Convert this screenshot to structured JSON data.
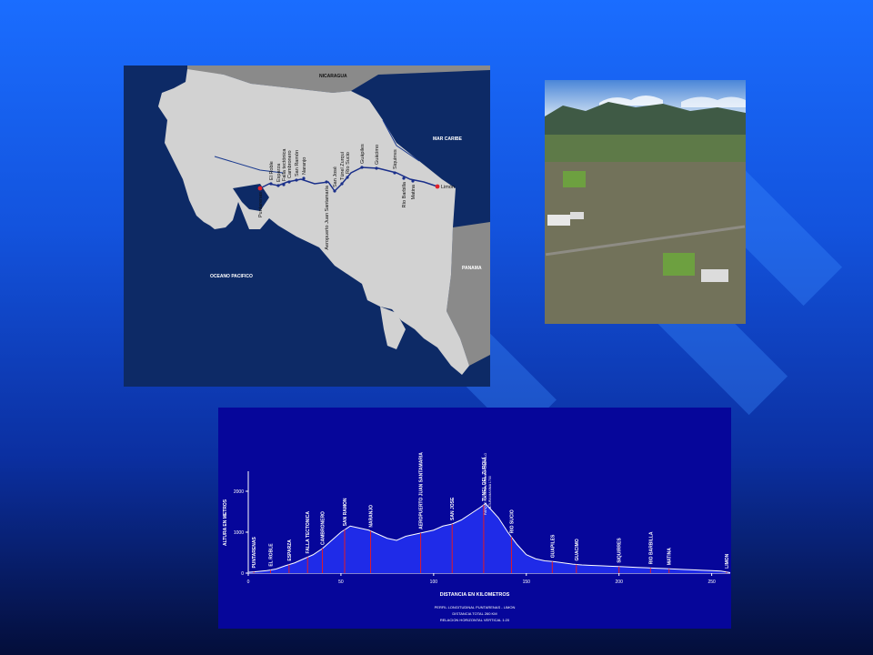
{
  "map": {
    "regions": {
      "nicaragua": "NICARAGUA",
      "caribbean": "MAR CARIBE",
      "pacific": "OCEANO PACIFICO",
      "panama": "PANAMA"
    },
    "stations": [
      "Puntarenas",
      "El Roble",
      "Esparza",
      "Falla tectónica",
      "Cambronero",
      "San Ramón",
      "Naranjo",
      "Aeropuerto Juan Santamaría",
      "San José",
      "Túnel Zurquí",
      "Río Sucio",
      "Guápiles",
      "Guácimo",
      "Siquirres",
      "Río Barbilla",
      "Matina",
      "Limón"
    ]
  },
  "photo": {
    "description_icon": "aerial-city-photo-icon"
  },
  "profile": {
    "y_axis_label": "ALTURA EN METROS",
    "x_axis_label": "DISTANCIA EN KILOMETROS",
    "y_ticks": [
      "2000",
      "1000",
      "0"
    ],
    "x_ticks": [
      "0",
      "50",
      "100",
      "150",
      "200",
      "250"
    ],
    "place_labels": [
      "PUNTARENAS",
      "EL ROBLE",
      "ESPARZA",
      "FALLA TECTONICA",
      "CAMBRONERO",
      "SAN RAMON",
      "NARANJO",
      "AEROPUERTO JUAN SANTAMARIA",
      "SAN JOSE",
      "TUNEL DEL ZURQUÍ",
      "RIO SUCIO",
      "GUAPILES",
      "GUACIMO",
      "SIQUIRRES",
      "RIO BARBILLA",
      "MATINA",
      "LIMON"
    ],
    "zurqui_note_1": "PARQUE NACIONAL BRAULIO CARRILLO",
    "zurqui_note_2": "ALTURA MAXIMA 1700",
    "caption_1": "PERFIL LONGITUDINAL PUNTARENAS - LIMON",
    "caption_2": "DISTANCIA TOTAL 260 KM",
    "caption_3": "RELACION HORIZONTAL VERTICAL 1:20",
    "elevation_km": [
      0,
      5,
      10,
      15,
      20,
      25,
      30,
      35,
      40,
      45,
      50,
      55,
      60,
      65,
      70,
      75,
      80,
      85,
      90,
      95,
      100,
      105,
      110,
      115,
      120,
      125,
      128,
      130,
      135,
      140,
      145,
      150,
      155,
      160,
      165,
      170,
      175,
      180,
      185,
      190,
      195,
      200,
      205,
      210,
      215,
      220,
      225,
      230,
      235,
      240,
      245,
      250,
      255,
      260
    ],
    "elevation_m": [
      20,
      40,
      60,
      100,
      180,
      250,
      350,
      450,
      600,
      800,
      1000,
      1150,
      1100,
      1050,
      950,
      850,
      800,
      900,
      950,
      1000,
      1050,
      1150,
      1200,
      1300,
      1450,
      1600,
      1700,
      1600,
      1350,
      1000,
      700,
      450,
      350,
      300,
      280,
      250,
      220,
      200,
      190,
      180,
      170,
      160,
      150,
      140,
      130,
      120,
      110,
      100,
      90,
      80,
      70,
      60,
      50,
      10
    ]
  }
}
